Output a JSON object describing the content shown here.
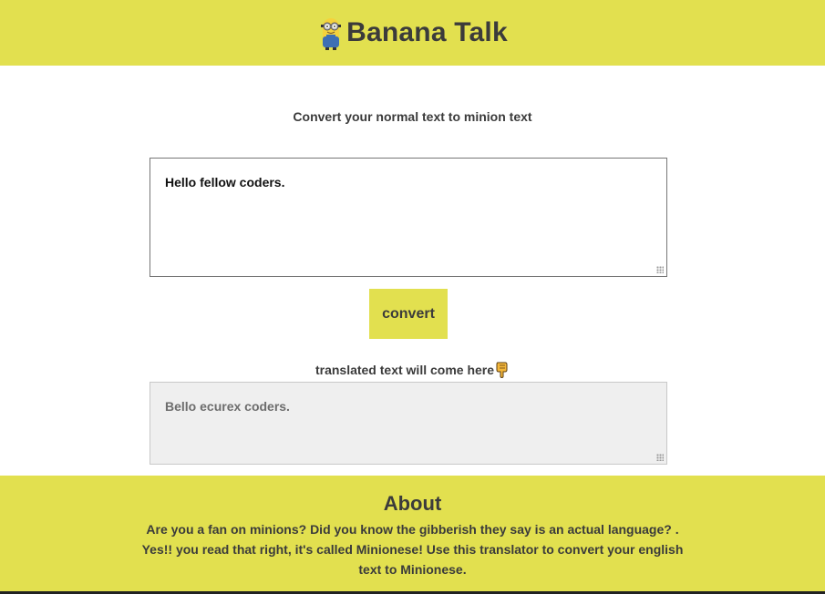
{
  "header": {
    "title": "Banana Talk",
    "logo_icon": "minion-icon",
    "background": "#e2e04f"
  },
  "main": {
    "subtitle": "Convert your normal text to minion text",
    "input": {
      "value": "Hello fellow coders."
    },
    "convert_label": "convert",
    "output_label": "translated text will come here",
    "output_icon": "pointing-down-hand-icon",
    "output": {
      "value": "Bello ecurex coders."
    }
  },
  "footer": {
    "about_title": "About",
    "about_text": "Are you a fan on minions? Did you know the gibberish they say is an actual language? . Yes!! you read that right, it's called Minionese! Use this translator to convert your english text to Minionese."
  },
  "colors": {
    "accent": "#e2e04f",
    "text": "#3b3b3b"
  }
}
